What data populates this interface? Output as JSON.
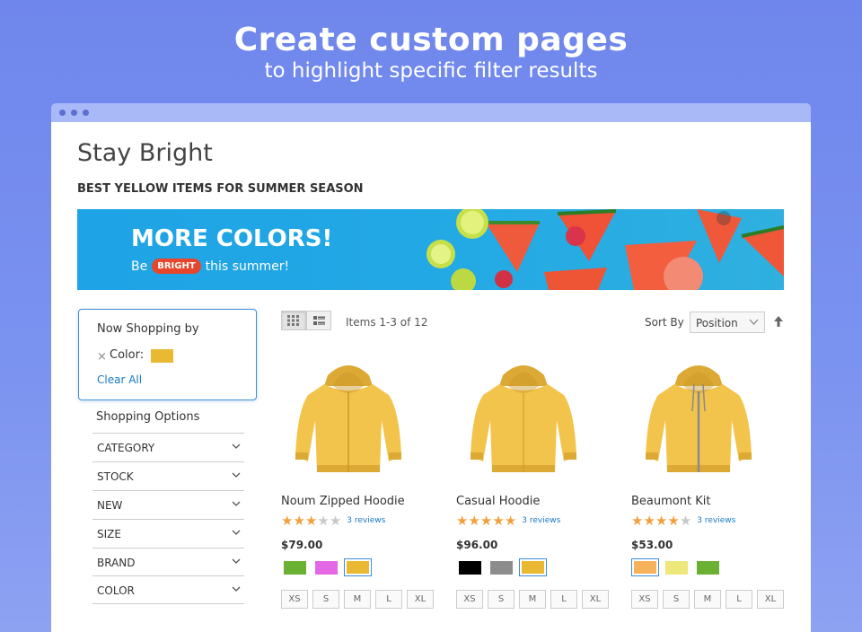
{
  "hero": {
    "title": "Create custom pages",
    "subtitle": "to highlight specific filter results"
  },
  "page": {
    "title": "Stay Bright",
    "subtitle": "BEST YELLOW ITEMS FOR SUMMER SEASON"
  },
  "banner": {
    "headline": "MORE COLORS!",
    "line_pre": "Be",
    "pill": "BRIGHT",
    "line_post": "this summer!"
  },
  "now_shopping": {
    "title": "Now Shopping by",
    "filter_label": "Color:",
    "filter_color": "#e8b931",
    "remove_symbol": "×",
    "clear_all": "Clear All"
  },
  "shopping_options": {
    "title": "Shopping Options",
    "facets": [
      "CATEGORY",
      "STOCK",
      "NEW",
      "SIZE",
      "BRAND",
      "COLOR"
    ]
  },
  "toolbar": {
    "items_count": "Items 1-3 of 12",
    "sort_label": "Sort By",
    "sort_value": "Position"
  },
  "products": [
    {
      "name": "Noum Zipped Hoodie",
      "rating": 3,
      "reviews": "3 reviews",
      "price": "$79.00",
      "swatches": [
        "#6ab033",
        "#e467e4",
        "#e8b931"
      ],
      "selected_swatch": 2,
      "sizes": [
        "XS",
        "S",
        "M",
        "L",
        "XL"
      ]
    },
    {
      "name": "Casual Hoodie",
      "rating": 5,
      "reviews": "3 reviews",
      "price": "$96.00",
      "swatches": [
        "#000000",
        "#8c8c8c",
        "#e8b931"
      ],
      "selected_swatch": 2,
      "sizes": [
        "XS",
        "S",
        "M",
        "L",
        "XL"
      ]
    },
    {
      "name": "Beaumont Kit",
      "rating": 4,
      "reviews": "3 reviews",
      "price": "$53.00",
      "swatches": [
        "#f6b25b",
        "#eee77a",
        "#6ab033"
      ],
      "selected_swatch": 0,
      "sizes": [
        "XS",
        "S",
        "M",
        "L",
        "XL"
      ]
    }
  ],
  "colors": {
    "background": "#7a92f0",
    "link": "#1979c3",
    "star": "#f29f3c",
    "banner": "#1ea3e6"
  }
}
